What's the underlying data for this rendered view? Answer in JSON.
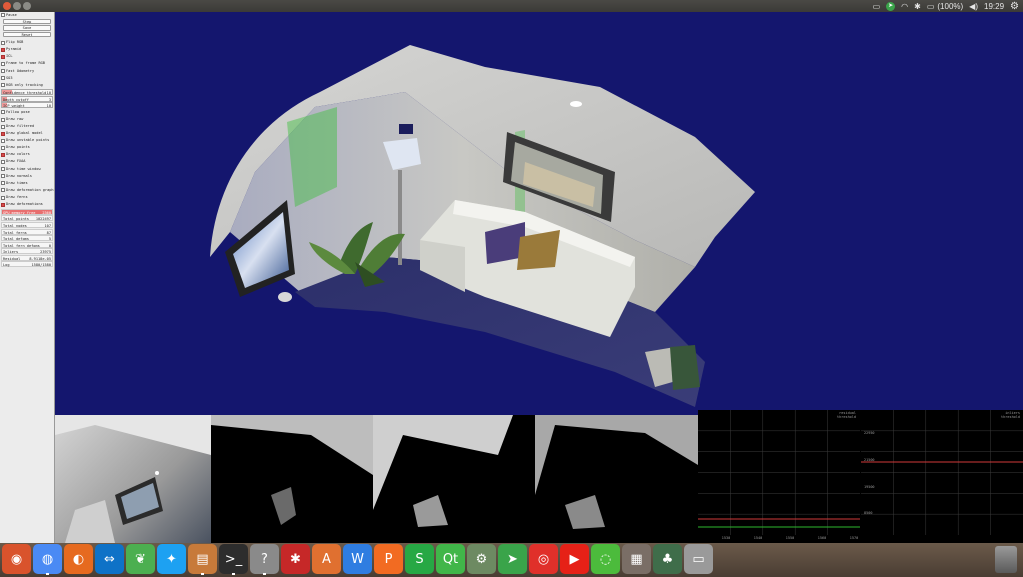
{
  "topbar": {
    "battery": "(100%)",
    "time": "19:29"
  },
  "panel": {
    "buttons": [
      "Pause",
      "Step",
      "Save",
      "Reset"
    ],
    "checks_top": [
      {
        "label": "Flip RGB",
        "checked": false
      },
      {
        "label": "Pyramid",
        "checked": true
      },
      {
        "label": "ICL",
        "checked": true
      },
      {
        "label": "Frame to frame RGB",
        "checked": false
      },
      {
        "label": "Fast Odometry",
        "checked": false
      },
      {
        "label": "SO3",
        "checked": false
      },
      {
        "label": "RGB only tracking",
        "checked": false
      }
    ],
    "sliders": [
      {
        "label": "Confidence threshold",
        "value": "10",
        "level": 0.2
      },
      {
        "label": "Depth cutoff",
        "value": "3",
        "level": 0.1
      },
      {
        "label": "ICP weight",
        "value": "10",
        "level": 0.1
      }
    ],
    "checks_bottom": [
      {
        "label": "Follow pose",
        "checked": false
      },
      {
        "label": "Draw raw",
        "checked": false
      },
      {
        "label": "Draw filtered",
        "checked": false
      },
      {
        "label": "Draw global model",
        "checked": true
      },
      {
        "label": "Draw unstable points",
        "checked": false
      },
      {
        "label": "Draw points",
        "checked": false
      },
      {
        "label": "Draw colors",
        "checked": true
      },
      {
        "label": "Draw FXAA",
        "checked": false
      },
      {
        "label": "Draw time window",
        "checked": false
      },
      {
        "label": "Draw normals",
        "checked": false
      },
      {
        "label": "Draw times",
        "checked": false
      },
      {
        "label": "Draw deformation graph",
        "checked": false
      },
      {
        "label": "Draw ferns",
        "checked": false
      },
      {
        "label": "Draw deformations",
        "checked": true
      }
    ],
    "stats": [
      {
        "label": "GPU memory free",
        "value": "2360",
        "highlight": true
      },
      {
        "label": "Total points",
        "value": "1022497",
        "highlight": false
      },
      {
        "label": "Total nodes",
        "value": "107",
        "highlight": false
      },
      {
        "label": "Total ferns",
        "value": "87",
        "highlight": false
      },
      {
        "label": "Total defoms",
        "value": "5",
        "highlight": false
      },
      {
        "label": "Total fern defoms",
        "value": "0",
        "highlight": false
      },
      {
        "label": "Inliers",
        "value": "23975",
        "highlight": false
      },
      {
        "label": "Residual",
        "value": "8.9118e-05",
        "highlight": false
      },
      {
        "label": "Log",
        "value": "1580/1580",
        "highlight": false
      }
    ]
  },
  "graphs": {
    "left_legend": [
      "residual",
      "threshold"
    ],
    "right_legend": [
      "inliers",
      "threshold"
    ],
    "left_y": [
      "22950",
      "21500",
      "19500",
      "8500"
    ],
    "x_ticks": [
      "1530",
      "1540",
      "1550",
      "1560",
      "1570"
    ],
    "colors": {
      "red": "#d23a3a",
      "green": "#2eb82e",
      "grid": "#3c3c3c"
    }
  },
  "dock": {
    "icons": [
      {
        "name": "ubuntu-icon",
        "glyph": "◉",
        "color": "#d9532c",
        "running": false
      },
      {
        "name": "chrome-icon",
        "glyph": "◍",
        "color": "#4a8af4",
        "running": true
      },
      {
        "name": "firefox-icon",
        "glyph": "◐",
        "color": "#e66a1f",
        "running": false
      },
      {
        "name": "teamviewer-icon",
        "glyph": "⇔",
        "color": "#0e72c7",
        "running": false
      },
      {
        "name": "leaf-icon",
        "glyph": "❦",
        "color": "#4caf50",
        "running": false
      },
      {
        "name": "twitter-icon",
        "glyph": "✦",
        "color": "#1da1f2",
        "running": false
      },
      {
        "name": "files-icon",
        "glyph": "▤",
        "color": "#c77a3a",
        "running": true
      },
      {
        "name": "terminal-icon",
        "glyph": ">_",
        "color": "#2d2d2d",
        "running": true
      },
      {
        "name": "help-icon",
        "glyph": "?",
        "color": "#8a8a8a",
        "running": true
      },
      {
        "name": "settings-icon",
        "glyph": "✱",
        "color": "#c62828",
        "running": false
      },
      {
        "name": "software-center-icon",
        "glyph": "A",
        "color": "#e07030",
        "running": false
      },
      {
        "name": "wps-writer-icon",
        "glyph": "W",
        "color": "#2f7de1",
        "running": false
      },
      {
        "name": "wps-presentation-icon",
        "glyph": "P",
        "color": "#f26b22",
        "running": false
      },
      {
        "name": "wps-spreadsheet-icon",
        "glyph": "S",
        "color": "#27a844",
        "running": false
      },
      {
        "name": "qt-creator-icon",
        "glyph": "Qt",
        "color": "#41b649",
        "running": false
      },
      {
        "name": "system-settings-icon",
        "glyph": "⚙",
        "color": "#6d8a62",
        "running": false
      },
      {
        "name": "telegram-icon",
        "glyph": "➤",
        "color": "#3aa44a",
        "running": false
      },
      {
        "name": "weibo-icon",
        "glyph": "◎",
        "color": "#e0302a",
        "running": false
      },
      {
        "name": "youtube-icon",
        "glyph": "▶",
        "color": "#e62117",
        "running": false
      },
      {
        "name": "wechat-icon",
        "glyph": "◌",
        "color": "#4cbb3c",
        "running": false
      },
      {
        "name": "workspace-icon",
        "glyph": "▦",
        "color": "#7a6e66",
        "running": false
      },
      {
        "name": "evernote-icon",
        "glyph": "♣",
        "color": "#3f6d4a",
        "running": false
      },
      {
        "name": "drive-icon",
        "glyph": "▭",
        "color": "#9a9a9a",
        "running": false
      }
    ]
  }
}
